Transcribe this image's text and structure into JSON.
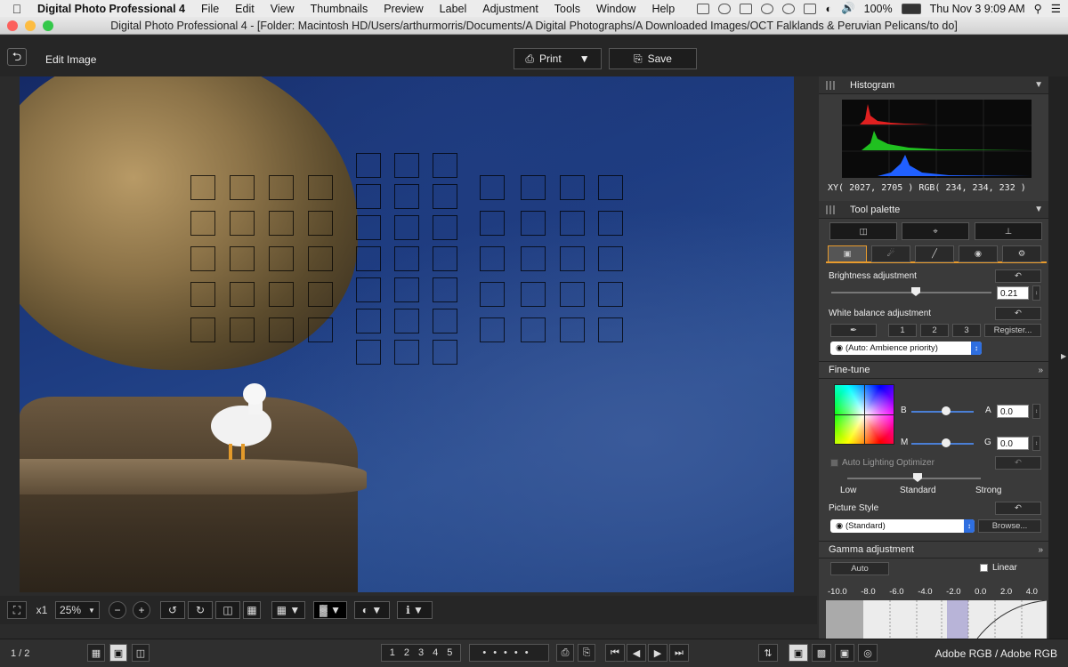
{
  "menubar": {
    "app": "Digital Photo Professional 4",
    "items": [
      "File",
      "Edit",
      "View",
      "Thumbnails",
      "Preview",
      "Label",
      "Adjustment",
      "Tools",
      "Window",
      "Help"
    ],
    "battery": "100%",
    "clock": "Thu Nov 3  9:09 AM"
  },
  "window": {
    "title": "Digital Photo Professional 4 - [Folder: Macintosh HD/Users/arthurmorris/Documents/A Digital Photographs/A Downloaded Images/OCT Falklands & Peruvian Pelicans/to do]"
  },
  "toolbar": {
    "back_label": "⮌",
    "edit_title": "Edit Image",
    "print_label": "Print",
    "save_label": "Save"
  },
  "image_toolbar": {
    "zoom_mult": "x1",
    "zoom_value": "25%"
  },
  "status": {
    "page_count": "1 / 2",
    "color_space": "Adobe RGB / Adobe RGB",
    "ratings": [
      "1",
      "2",
      "3",
      "4",
      "5"
    ]
  },
  "histogram": {
    "title": "Histogram",
    "xy_readout": "XY(  2027,  2705 ) RGB( 234,  234,  232 )",
    "channel_colors": [
      "#e02020",
      "#20d020",
      "#2060ff"
    ]
  },
  "tool_palette": {
    "title": "Tool palette",
    "brightness": {
      "label": "Brightness adjustment",
      "value": "0.21"
    },
    "white_balance": {
      "label": "White balance adjustment",
      "preset_buttons": [
        "1",
        "2",
        "3"
      ],
      "register_label": "Register...",
      "mode": "(Auto: Ambience priority)"
    },
    "fine_tune": {
      "label": "Fine-tune",
      "b_label": "B",
      "a_label": "A",
      "a_value": "0.0",
      "m_label": "M",
      "g_label": "G",
      "g_value": "0.0"
    },
    "alo": {
      "label": "Auto Lighting Optimizer",
      "low": "Low",
      "standard": "Standard",
      "strong": "Strong"
    },
    "picture_style": {
      "label": "Picture Style",
      "value": "(Standard)",
      "browse_label": "Browse..."
    },
    "gamma": {
      "label": "Gamma adjustment",
      "auto_label": "Auto",
      "linear_label": "Linear",
      "scale": [
        "-10.0",
        "-8.0",
        "-6.0",
        "-4.0",
        "-2.0",
        "0.0",
        "2.0",
        "4.0"
      ]
    }
  }
}
